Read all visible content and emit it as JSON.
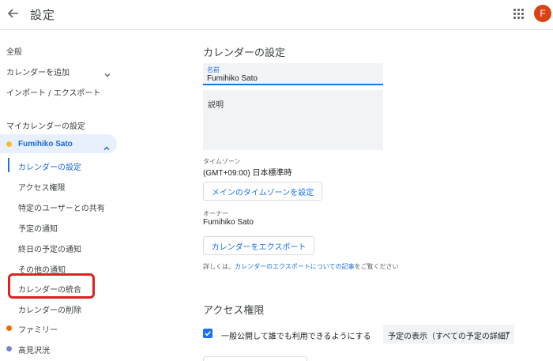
{
  "header": {
    "title": "設定",
    "avatar_letter": "F",
    "avatar_color": "#d84315"
  },
  "sidebar": {
    "general": "全般",
    "add_calendar": "カレンダーを追加",
    "import_export": "インポート / エクスポート",
    "my_calendars_heading": "マイカレンダーの設定",
    "current_calendar": "Fumihiko Sato",
    "sub_items": [
      "カレンダーの設定",
      "アクセス権限",
      "特定のユーザーとの共有",
      "予定の通知",
      "終日の予定の通知",
      "その他の通知",
      "カレンダーの統合",
      "カレンダーの削除"
    ],
    "other_calendars": [
      {
        "name": "ファミリー",
        "color": "#ef6c00"
      },
      {
        "name": "髙見沢洸",
        "color": "#7986cb"
      }
    ],
    "current_calendar_color": "#f6bf26"
  },
  "main": {
    "calendar_settings_title": "カレンダーの設定",
    "name_label": "名前",
    "name_value": "Fumihiko Sato",
    "description_placeholder": "説明",
    "timezone_label": "タイムゾーン",
    "timezone_value": "(GMT+09:00) 日本標準時",
    "set_main_timezone_button": "メインのタイムゾーンを設定",
    "owner_label": "オーナー",
    "owner_value": "Fumihiko Sato",
    "export_button": "カレンダーをエクスポート",
    "help_prefix": "詳しくは、",
    "help_link": "カレンダーのエクスポートについての記事",
    "help_suffix": "をご覧ください",
    "access_title": "アクセス権限",
    "public_checkbox_label": "一般公開して誰でも利用できるようにする",
    "public_checked": true,
    "visibility_select": "予定の表示（すべての予定の詳細）"
  },
  "colors": {
    "accent": "#1a73e8",
    "highlight": "#e02020"
  }
}
